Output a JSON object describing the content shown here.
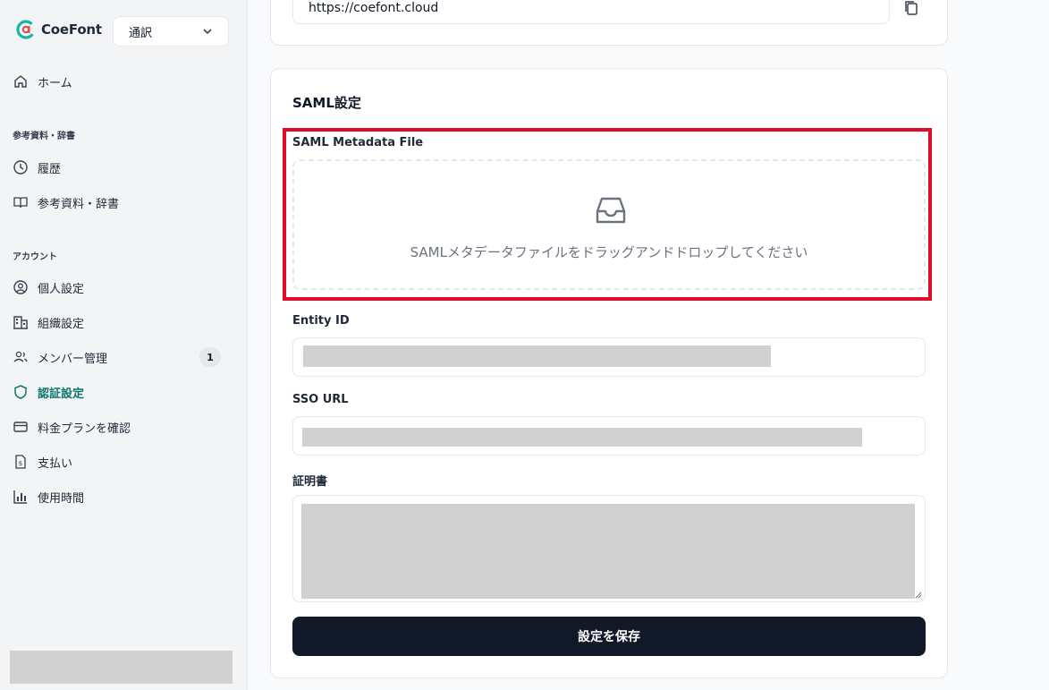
{
  "brand": {
    "name": "CoeFont"
  },
  "mode_select": {
    "value": "通訳"
  },
  "nav": {
    "home": "ホーム",
    "section_reference": "参考資料・辞書",
    "history": "履歴",
    "reference": "参考資料・辞書",
    "section_account": "アカウント",
    "personal": "個人設定",
    "organization": "組織設定",
    "members": "メンバー管理",
    "members_badge": "1",
    "auth": "認証設定",
    "plan": "料金プランを確認",
    "payment": "支払い",
    "usage": "使用時間"
  },
  "top_card": {
    "url": "https://coefont.cloud"
  },
  "saml": {
    "title": "SAML設定",
    "metadata_label": "SAML Metadata File",
    "dropzone_text": "SAMLメタデータファイルをドラッグアンドドロップしてください",
    "entity_label": "Entity ID",
    "sso_label": "SSO URL",
    "cert_label": "証明書",
    "save_label": "設定を保存"
  },
  "colors": {
    "accent": "#0f766e",
    "highlight": "#e00b2a",
    "button": "#111827"
  }
}
